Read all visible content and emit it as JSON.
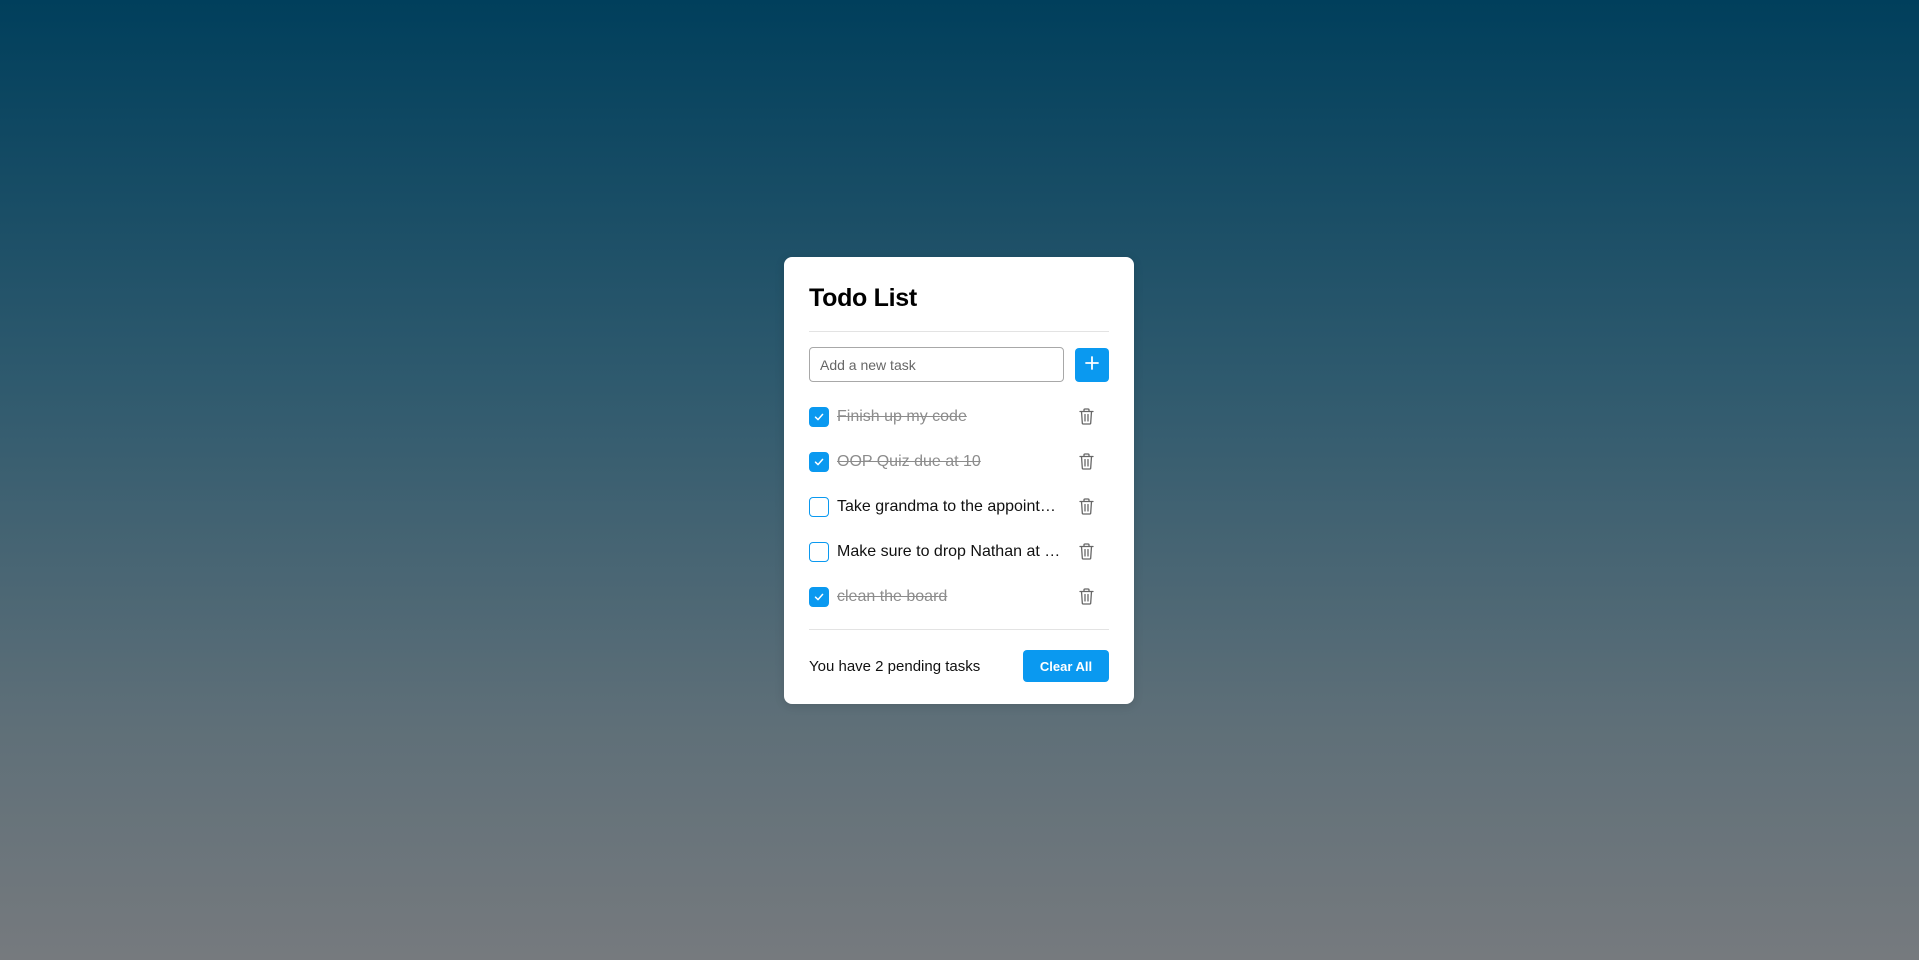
{
  "app": {
    "title": "Todo List"
  },
  "input": {
    "placeholder": "Add a new task",
    "value": "",
    "add_icon": "plus-icon"
  },
  "tasks": [
    {
      "text": "Finish up my code",
      "done": true
    },
    {
      "text": "OOP Quiz due at 10",
      "done": true
    },
    {
      "text": "Take grandma to the appointment",
      "done": false
    },
    {
      "text": "Make sure to drop Nathan at school",
      "done": false
    },
    {
      "text": "clean the board",
      "done": true
    }
  ],
  "footer": {
    "pending_text": "You have 2 pending tasks",
    "clear_label": "Clear All"
  },
  "icons": {
    "check": "check-icon",
    "delete": "trash-icon"
  },
  "colors": {
    "accent": "#0a99f0",
    "done_text": "#8c8c8c",
    "background_top": "#003f5c",
    "background_bottom": "#767a7e"
  }
}
